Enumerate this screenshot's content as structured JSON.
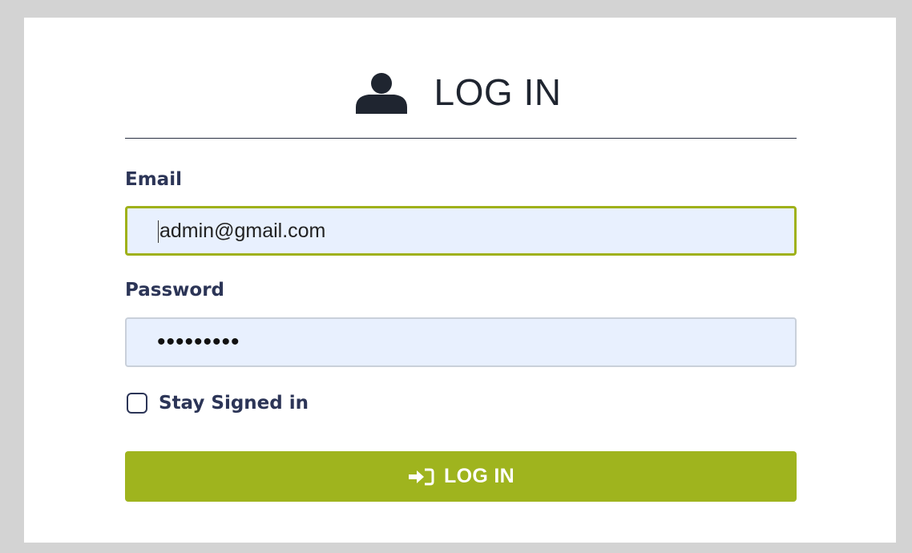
{
  "header": {
    "title": "LOG IN",
    "icon": "user-icon"
  },
  "form": {
    "email": {
      "label": "Email",
      "value": "admin@gmail.com"
    },
    "password": {
      "label": "Password",
      "masked_value": "•••••••••"
    },
    "stay_signed_in": {
      "label": "Stay Signed in",
      "checked": false
    },
    "submit": {
      "label": "LOG IN",
      "icon": "sign-in-icon"
    }
  },
  "colors": {
    "accent": "#9fb41e",
    "label": "#2c3557",
    "input_bg": "#e8f0fe",
    "heading": "#1f2530",
    "backdrop": "#d3d3d3"
  }
}
